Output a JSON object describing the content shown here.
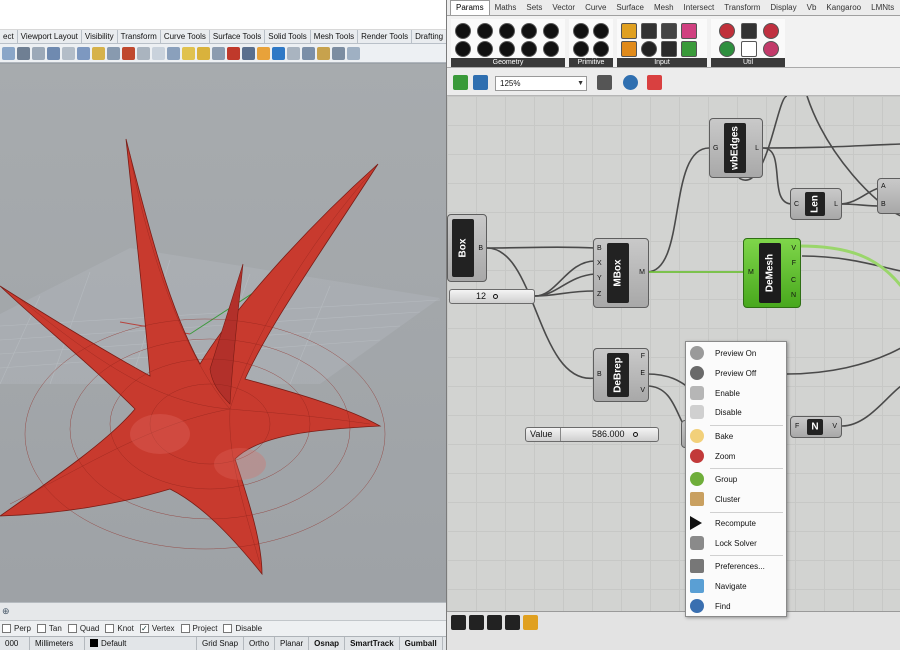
{
  "rhino": {
    "toolbar_tabs": [
      "ect",
      "Viewport Layout",
      "Visibility",
      "Transform",
      "Curve Tools",
      "Surface Tools",
      "Solid Tools",
      "Mesh Tools",
      "Render Tools",
      "Drafting"
    ],
    "osnaps": [
      {
        "label": "Perp",
        "checked": false
      },
      {
        "label": "Tan",
        "checked": false
      },
      {
        "label": "Quad",
        "checked": false
      },
      {
        "label": "Knot",
        "checked": false
      },
      {
        "label": "Vertex",
        "checked": true
      },
      {
        "label": "Project",
        "checked": false
      },
      {
        "label": "Disable",
        "checked": false
      }
    ],
    "status": {
      "coord": "000",
      "units": "Millimeters",
      "layer": "Default",
      "layer_color": "#000000",
      "grid_snap": "Grid Snap",
      "ortho": "Ortho",
      "planar": "Planar",
      "osnap": "Osnap",
      "smarttrack": "SmartTrack",
      "gumball": "Gumball"
    },
    "viewport_tab_icon": "plus-icon",
    "model_color": "#c83a2e",
    "viewport_bg": "#9ea2a6"
  },
  "gh": {
    "tabs": [
      "Params",
      "Maths",
      "Sets",
      "Vector",
      "Curve",
      "Surface",
      "Mesh",
      "Intersect",
      "Transform",
      "Display",
      "Vb",
      "Kangaroo",
      "LMNts"
    ],
    "active_tab": "Params",
    "ribbon_groups": [
      "Geometry",
      "Primitive",
      "Input",
      "Util"
    ],
    "zoom": "125%",
    "components": {
      "box": {
        "name": "Box",
        "outputs": [
          "B"
        ]
      },
      "mbox": {
        "name": "MBox",
        "inputs": [
          "B",
          "X",
          "Y",
          "Z"
        ],
        "outputs": [
          "M"
        ]
      },
      "wbedges": {
        "name": "wbEdges",
        "inputs": [
          "G"
        ],
        "outputs": [
          "L"
        ]
      },
      "len": {
        "name": "Len",
        "inputs": [
          "C"
        ],
        "outputs": [
          "L"
        ]
      },
      "demesh": {
        "name": "DeMesh",
        "inputs": [
          "M"
        ],
        "outputs": [
          "V",
          "F",
          "C",
          "N"
        ]
      },
      "debrep": {
        "name": "DeBrep",
        "inputs": [
          "B"
        ],
        "outputs": [
          "F",
          "E",
          "V"
        ]
      },
      "n": {
        "name": "N",
        "inputs": [
          "F"
        ],
        "outputs": [
          "V"
        ]
      },
      "a_partial": {
        "inputs": [
          "A",
          "B"
        ]
      }
    },
    "slider_12": {
      "value": "12"
    },
    "slider_value": {
      "label": "Value",
      "value": "586.000"
    },
    "context_menu": [
      {
        "label": "Preview On",
        "icon": "preview-on-icon"
      },
      {
        "label": "Preview Off",
        "icon": "preview-off-icon"
      },
      {
        "label": "Enable",
        "icon": "enable-icon"
      },
      {
        "label": "Disable",
        "icon": "disable-icon"
      },
      {
        "label": "Bake",
        "icon": "bake-egg-icon"
      },
      {
        "label": "Zoom",
        "icon": "zoom-icon"
      },
      {
        "label": "Group",
        "icon": "group-icon"
      },
      {
        "label": "Cluster",
        "icon": "cluster-icon"
      },
      {
        "label": "Recompute",
        "icon": "recompute-icon"
      },
      {
        "label": "Lock Solver",
        "icon": "lock-icon"
      },
      {
        "label": "Preferences...",
        "icon": "preferences-icon"
      },
      {
        "label": "Navigate",
        "icon": "navigate-icon"
      },
      {
        "label": "Find",
        "icon": "find-icon"
      }
    ],
    "wire_color": "#4a4a4a",
    "selected_wire_color": "#7fd03f"
  }
}
